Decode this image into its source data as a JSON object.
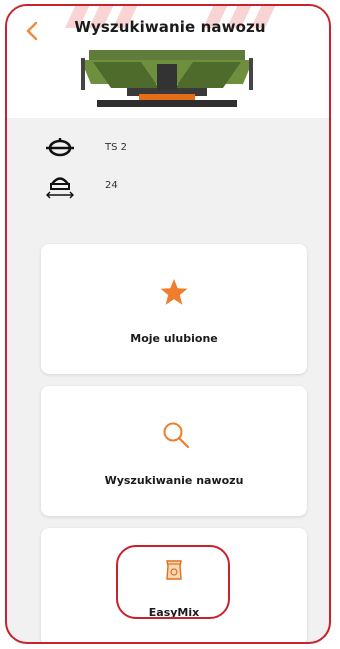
{
  "header": {
    "title": "Wyszukiwanie nawozu",
    "back_icon": "chevron-left-icon"
  },
  "machine": {
    "disc_type": "TS 2",
    "working_width": "24"
  },
  "menu": [
    {
      "label": "Moje ulubione",
      "icon": "star-icon"
    },
    {
      "label": "Wyszukiwanie nawozu",
      "icon": "search-icon"
    },
    {
      "label": "EasyMix",
      "icon": "fertilizer-bag-icon"
    }
  ],
  "colors": {
    "accent_orange": "#f07d2c",
    "highlight_red": "#c8232c",
    "background": "#f1f1f1"
  }
}
